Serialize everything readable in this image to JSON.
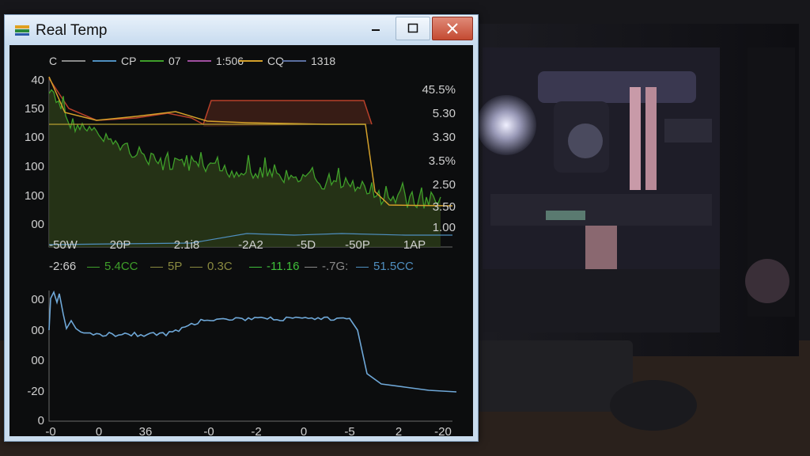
{
  "window": {
    "title": "Real Temp",
    "minimize_glyph": "—",
    "maximize_glyph": "☐",
    "close_glyph": "✕"
  },
  "top_chart": {
    "legend": [
      {
        "label": "C",
        "color": "#8a8a8a"
      },
      {
        "label": "CP",
        "color": "#4f8fc0"
      },
      {
        "label": "07",
        "color": "#3f9f2a"
      },
      {
        "label": "1:506",
        "color": "#a04fa0"
      },
      {
        "label": "CQ",
        "color": "#d4a02a"
      },
      {
        "label": "1318",
        "color": "#5a6fa0"
      }
    ],
    "left_ticks": [
      "40",
      "150",
      "100",
      "100",
      "100",
      "00"
    ],
    "right_ticks": [
      "45.5%",
      "5.30",
      "3.30",
      "3.5%",
      "2.50",
      "3.50",
      "1.00"
    ],
    "bottom_ticks": [
      "-50W",
      "20P",
      "2.1i8",
      "-2A2",
      "-5D",
      "-50P",
      "1AP"
    ]
  },
  "stats_row": [
    {
      "label": "-2:66",
      "color": "#cfcfcf"
    },
    {
      "label": "5.4CC",
      "color": "#3f9f2a"
    },
    {
      "label": "5P",
      "color": "#8a8a40"
    },
    {
      "label": "0.3C",
      "color": "#8a8a40"
    },
    {
      "label": "-11.16",
      "color": "#3fbf3a"
    },
    {
      "label": "-.7G:",
      "color": "#8a8a8a"
    },
    {
      "label": "51.5CC",
      "color": "#4f8fc0"
    }
  ],
  "bottom_chart": {
    "left_ticks": [
      "00",
      "00",
      "00",
      "-20",
      "0"
    ],
    "bottom_ticks": [
      "-0",
      "0",
      "36",
      "-0",
      "-2",
      "0",
      "-5",
      "2",
      "-20"
    ]
  },
  "colors": {
    "green": "#3f9f2a",
    "red": "#b8402a",
    "orange": "#d4a02a",
    "blue": "#4f8fc0"
  }
}
